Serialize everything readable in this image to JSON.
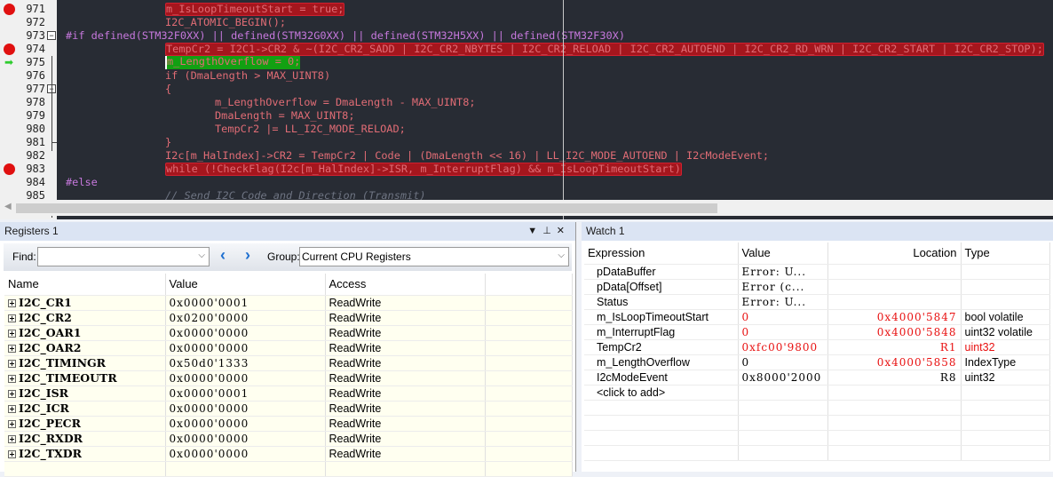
{
  "editor": {
    "lines": [
      {
        "num": "971",
        "text": "m_IsLoopTimeoutStart = true;",
        "indent": 2,
        "style": "hl",
        "bp": true
      },
      {
        "num": "972",
        "text": "I2C_ATOMIC_BEGIN();",
        "indent": 2,
        "style": ""
      },
      {
        "num": "973",
        "text": "#if defined(STM32F0XX) || defined(STM32G0XX) || defined(STM32H5XX) || defined(STM32F30X)",
        "indent": 0,
        "style": "pp",
        "fold": true
      },
      {
        "num": "974",
        "text": "TempCr2 = I2C1->CR2 & ~(I2C_CR2_SADD | I2C_CR2_NBYTES | I2C_CR2_RELOAD | I2C_CR2_AUTOEND | I2C_CR2_RD_WRN | I2C_CR2_START | I2C_CR2_STOP);",
        "indent": 2,
        "style": "hl",
        "bp": true
      },
      {
        "num": "975",
        "text": "m_LengthOverflow = 0;",
        "indent": 2,
        "style": "cur",
        "current": true
      },
      {
        "num": "976",
        "text": "if (DmaLength > MAX_UINT8)",
        "indent": 2,
        "style": ""
      },
      {
        "num": "977",
        "text": "{",
        "indent": 2,
        "style": "",
        "fold": true
      },
      {
        "num": "978",
        "text": "m_LengthOverflow = DmaLength - MAX_UINT8;",
        "indent": 3,
        "style": ""
      },
      {
        "num": "979",
        "text": "DmaLength = MAX_UINT8;",
        "indent": 3,
        "style": ""
      },
      {
        "num": "980",
        "text": "TempCr2 |= LL_I2C_MODE_RELOAD;",
        "indent": 3,
        "style": ""
      },
      {
        "num": "981",
        "text": "}",
        "indent": 2,
        "style": ""
      },
      {
        "num": "982",
        "text": "I2c[m_HalIndex]->CR2 = TempCr2 | Code | (DmaLength << 16) | LL_I2C_MODE_AUTOEND | I2cModeEvent;",
        "indent": 2,
        "style": ""
      },
      {
        "num": "983",
        "text": "while (!CheckFlag(I2c[m_HalIndex]->ISR, m_InterruptFlag) && m_IsLoopTimeoutStart)",
        "indent": 2,
        "style": "hl",
        "bp": true
      },
      {
        "num": "984",
        "text": "#else",
        "indent": 0,
        "style": "pp"
      },
      {
        "num": "985",
        "text": "// Send I2C Code and Direction (Transmit)",
        "indent": 2,
        "style": "cmt"
      }
    ]
  },
  "registers": {
    "title": "Registers 1",
    "find_label": "Find:",
    "find_value": "",
    "group_label": "Group:",
    "group_value": "Current CPU Registers",
    "columns": [
      "Name",
      "Value",
      "Access"
    ],
    "rows": [
      {
        "name": "I2C_CR1",
        "value": "0x0000'0001",
        "access": "ReadWrite"
      },
      {
        "name": "I2C_CR2",
        "value": "0x0200'0000",
        "access": "ReadWrite"
      },
      {
        "name": "I2C_OAR1",
        "value": "0x0000'0000",
        "access": "ReadWrite"
      },
      {
        "name": "I2C_OAR2",
        "value": "0x0000'0000",
        "access": "ReadWrite"
      },
      {
        "name": "I2C_TIMINGR",
        "value": "0x50d0'1333",
        "access": "ReadWrite"
      },
      {
        "name": "I2C_TIMEOUTR",
        "value": "0x0000'0000",
        "access": "ReadWrite"
      },
      {
        "name": "I2C_ISR",
        "value": "0x0000'0001",
        "access": "ReadWrite"
      },
      {
        "name": "I2C_ICR",
        "value": "0x0000'0000",
        "access": "ReadWrite"
      },
      {
        "name": "I2C_PECR",
        "value": "0x0000'0000",
        "access": "ReadWrite"
      },
      {
        "name": "I2C_RXDR",
        "value": "0x0000'0000",
        "access": "ReadWrite"
      },
      {
        "name": "I2C_TXDR",
        "value": "0x0000'0000",
        "access": "ReadWrite"
      }
    ]
  },
  "watch": {
    "title": "Watch 1",
    "columns": [
      "Expression",
      "Value",
      "Location",
      "Type"
    ],
    "rows": [
      {
        "expr": "pDataBuffer",
        "value": "Error: U...",
        "location": "",
        "type": ""
      },
      {
        "expr": "pData[Offset]",
        "value": "Error (c...",
        "location": "",
        "type": ""
      },
      {
        "expr": "Status",
        "value": "Error: U...",
        "location": "",
        "type": ""
      },
      {
        "expr": "m_IsLoopTimeoutStart",
        "value": "0",
        "location": "0x4000'5847",
        "type": "bool volatile",
        "vred": true,
        "lred": true
      },
      {
        "expr": "m_InterruptFlag",
        "value": "0",
        "location": "0x4000'5848",
        "type": "uint32 volatile",
        "vred": true,
        "lred": true
      },
      {
        "expr": "TempCr2",
        "value": "0xfc00'9800",
        "location": "R1",
        "type": "uint32",
        "vred": true,
        "lred": true,
        "tred": true
      },
      {
        "expr": "m_LengthOverflow",
        "value": "0",
        "location": "0x4000'5858",
        "type": "IndexType",
        "lred": true
      },
      {
        "expr": "I2cModeEvent",
        "value": "0x8000'2000",
        "location": "R8",
        "type": "uint32"
      }
    ],
    "add_label": "<click to add>"
  }
}
